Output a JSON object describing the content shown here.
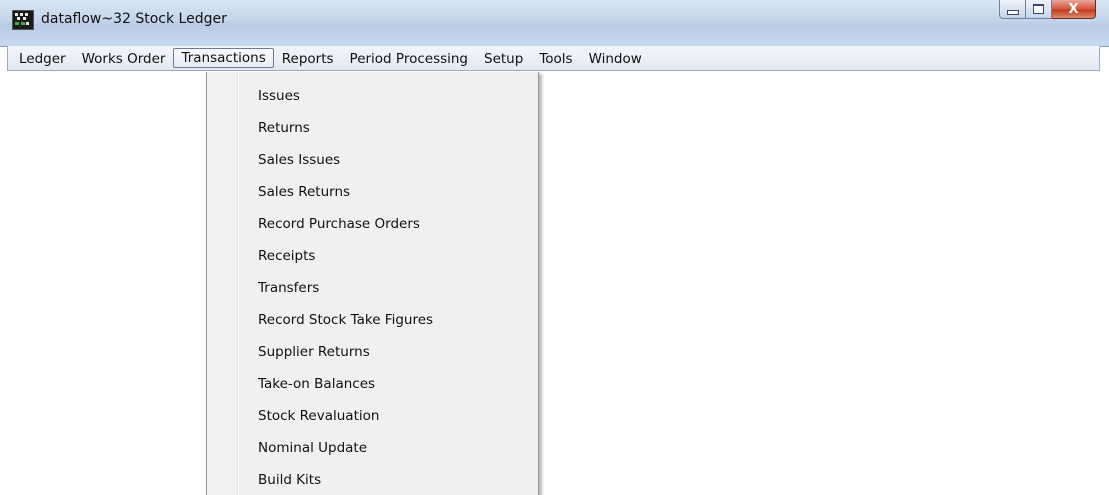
{
  "window": {
    "title": "dataflow~32 Stock Ledger",
    "caption_buttons": {
      "minimize_icon": "minimize-icon",
      "maximize_icon": "maximize-icon",
      "close_label": "X"
    }
  },
  "menubar": {
    "items": [
      {
        "label": "Ledger"
      },
      {
        "label": "Works Order"
      },
      {
        "label": "Transactions",
        "open": true
      },
      {
        "label": "Reports"
      },
      {
        "label": "Period Processing"
      },
      {
        "label": "Setup"
      },
      {
        "label": "Tools"
      },
      {
        "label": "Window"
      }
    ]
  },
  "transactions_menu": {
    "items": [
      {
        "label": "Issues"
      },
      {
        "label": "Returns"
      },
      {
        "label": "Sales Issues"
      },
      {
        "label": "Sales Returns"
      },
      {
        "label": "Record Purchase Orders"
      },
      {
        "label": "Receipts"
      },
      {
        "label": "Transfers"
      },
      {
        "label": "Record Stock Take Figures"
      },
      {
        "label": "Supplier Returns"
      },
      {
        "label": "Take-on Balances"
      },
      {
        "label": "Stock Revaluation"
      },
      {
        "label": "Nominal Update"
      },
      {
        "label": "Build Kits"
      }
    ]
  },
  "colors": {
    "titlebar": "#c4d5ea",
    "menubar": "#e9eef6",
    "dropdown_bg": "#f0f0f0",
    "close_button": "#c7432a"
  }
}
